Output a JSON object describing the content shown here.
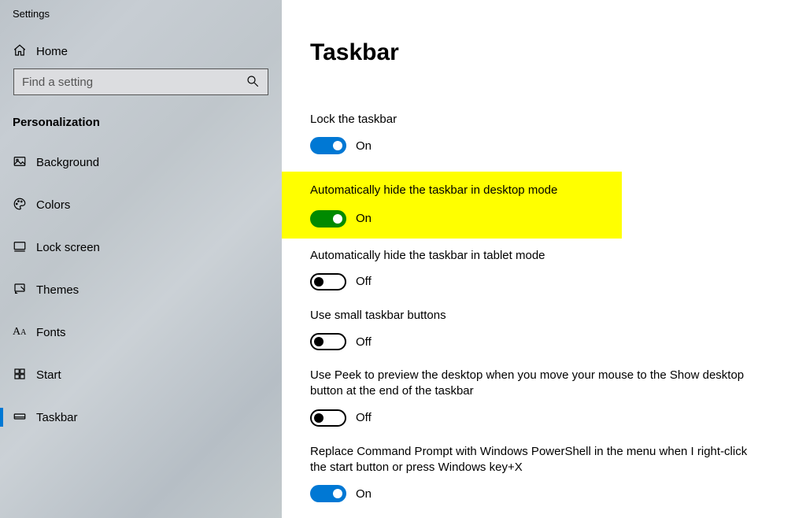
{
  "app_title": "Settings",
  "home_label": "Home",
  "search": {
    "placeholder": "Find a setting"
  },
  "section_title": "Personalization",
  "sidebar": {
    "items": [
      {
        "label": "Background"
      },
      {
        "label": "Colors"
      },
      {
        "label": "Lock screen"
      },
      {
        "label": "Themes"
      },
      {
        "label": "Fonts"
      },
      {
        "label": "Start"
      },
      {
        "label": "Taskbar"
      }
    ]
  },
  "page": {
    "title": "Taskbar",
    "settings": [
      {
        "label": "Lock the taskbar",
        "state": "On"
      },
      {
        "label": "Automatically hide the taskbar in desktop mode",
        "state": "On"
      },
      {
        "label": "Automatically hide the taskbar in tablet mode",
        "state": "Off"
      },
      {
        "label": "Use small taskbar buttons",
        "state": "Off"
      },
      {
        "label": "Use Peek to preview the desktop when you move your mouse to the Show desktop button at the end of the taskbar",
        "state": "Off"
      },
      {
        "label": "Replace Command Prompt with Windows PowerShell in the menu when I right-click the start button or press Windows key+X",
        "state": "On"
      }
    ]
  }
}
